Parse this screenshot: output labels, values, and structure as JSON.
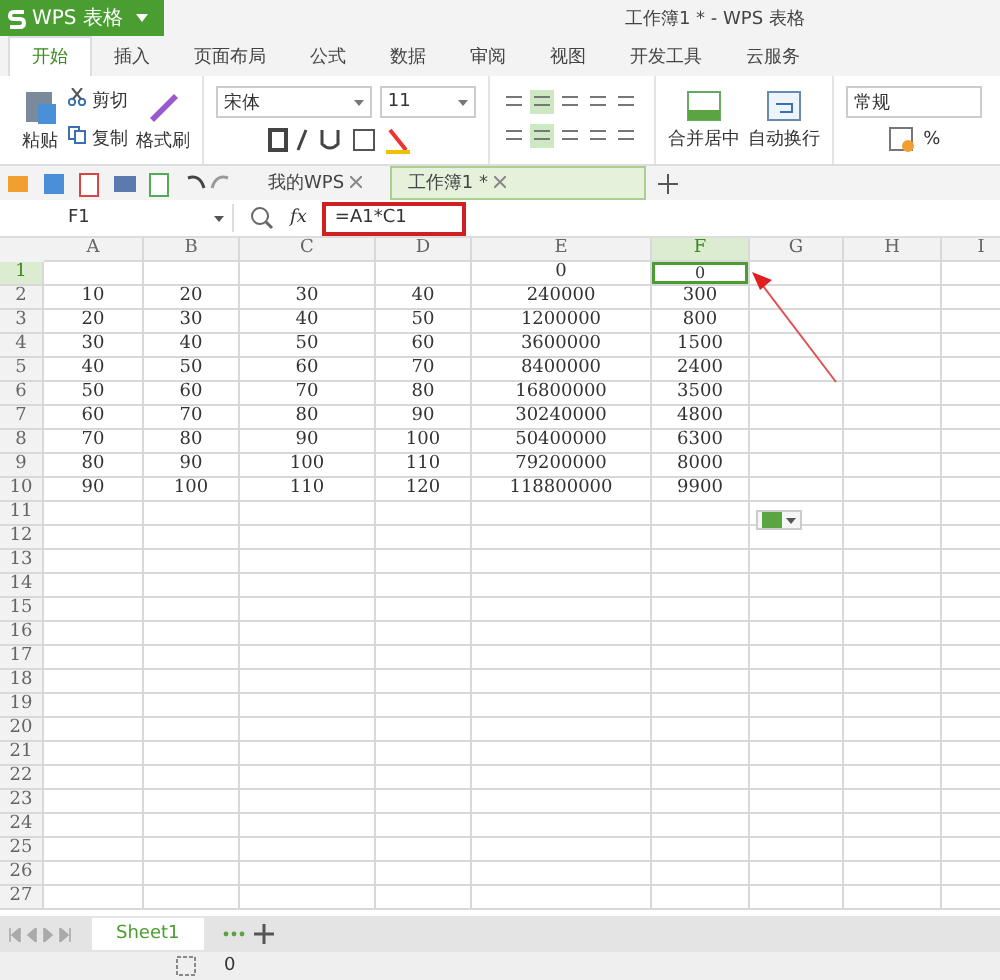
{
  "app_menu": {
    "label": "WPS 表格"
  },
  "window": {
    "title": "工作簿1 * - WPS 表格"
  },
  "tabs": [
    {
      "label": "开始",
      "selected": true
    },
    {
      "label": "插入",
      "selected": false
    },
    {
      "label": "页面布局",
      "selected": false
    },
    {
      "label": "公式",
      "selected": false
    },
    {
      "label": "数据",
      "selected": false
    },
    {
      "label": "审阅",
      "selected": false
    },
    {
      "label": "视图",
      "selected": false
    },
    {
      "label": "开发工具",
      "selected": false
    },
    {
      "label": "云服务",
      "selected": false
    }
  ],
  "ribbon": {
    "paste": "粘贴",
    "cut": "剪切",
    "copy": "复制",
    "format_painter": "格式刷",
    "font": "宋体",
    "font_size": "11",
    "merge": "合并居中",
    "wrap": "自动换行",
    "number_format": "常规",
    "percent": "%"
  },
  "doc_tabs": [
    {
      "label": "我的WPS",
      "selected": false
    },
    {
      "label": "工作簿1 *",
      "selected": true
    }
  ],
  "formula_bar": {
    "name_box": "F1",
    "fx": "fx",
    "formula": "=A1*C1"
  },
  "columns": [
    {
      "label": "A",
      "selected": false
    },
    {
      "label": "B",
      "selected": false
    },
    {
      "label": "C",
      "selected": false
    },
    {
      "label": "D",
      "selected": false
    },
    {
      "label": "E",
      "selected": false
    },
    {
      "label": "F",
      "selected": true
    },
    {
      "label": "G",
      "selected": false
    },
    {
      "label": "H",
      "selected": false
    },
    {
      "label": "I",
      "selected": false
    }
  ],
  "rows": [
    {
      "number": "1",
      "selected": true,
      "cells": [
        null,
        null,
        null,
        null,
        "0",
        "0",
        null,
        null,
        null
      ]
    },
    {
      "number": "2",
      "selected": false,
      "cells": [
        "10",
        "20",
        "30",
        "40",
        "240000",
        "300",
        null,
        null,
        null
      ]
    },
    {
      "number": "3",
      "selected": false,
      "cells": [
        "20",
        "30",
        "40",
        "50",
        "1200000",
        "800",
        null,
        null,
        null
      ]
    },
    {
      "number": "4",
      "selected": false,
      "cells": [
        "30",
        "40",
        "50",
        "60",
        "3600000",
        "1500",
        null,
        null,
        null
      ]
    },
    {
      "number": "5",
      "selected": false,
      "cells": [
        "40",
        "50",
        "60",
        "70",
        "8400000",
        "2400",
        null,
        null,
        null
      ]
    },
    {
      "number": "6",
      "selected": false,
      "cells": [
        "50",
        "60",
        "70",
        "80",
        "16800000",
        "3500",
        null,
        null,
        null
      ]
    },
    {
      "number": "7",
      "selected": false,
      "cells": [
        "60",
        "70",
        "80",
        "90",
        "30240000",
        "4800",
        null,
        null,
        null
      ]
    },
    {
      "number": "8",
      "selected": false,
      "cells": [
        "70",
        "80",
        "90",
        "100",
        "50400000",
        "6300",
        null,
        null,
        null
      ]
    },
    {
      "number": "9",
      "selected": false,
      "cells": [
        "80",
        "90",
        "100",
        "110",
        "79200000",
        "8000",
        null,
        null,
        null
      ]
    },
    {
      "number": "10",
      "selected": false,
      "cells": [
        "90",
        "100",
        "110",
        "120",
        "118800000",
        "9900",
        null,
        null,
        null
      ]
    },
    {
      "number": "11",
      "selected": false
    },
    {
      "number": "12",
      "selected": false
    },
    {
      "number": "13",
      "selected": false
    },
    {
      "number": "14",
      "selected": false
    },
    {
      "number": "15",
      "selected": false
    },
    {
      "number": "16",
      "selected": false
    },
    {
      "number": "17",
      "selected": false
    },
    {
      "number": "18",
      "selected": false
    },
    {
      "number": "19",
      "selected": false
    },
    {
      "number": "20",
      "selected": false
    },
    {
      "number": "21",
      "selected": false
    },
    {
      "number": "22",
      "selected": false
    },
    {
      "number": "23",
      "selected": false
    },
    {
      "number": "24",
      "selected": false
    },
    {
      "number": "25",
      "selected": false
    },
    {
      "number": "26",
      "selected": false
    },
    {
      "number": "27",
      "selected": false
    }
  ],
  "sheet_tabs": [
    {
      "label": "Sheet1",
      "selected": true
    }
  ],
  "status_bar": {
    "value": "0"
  }
}
